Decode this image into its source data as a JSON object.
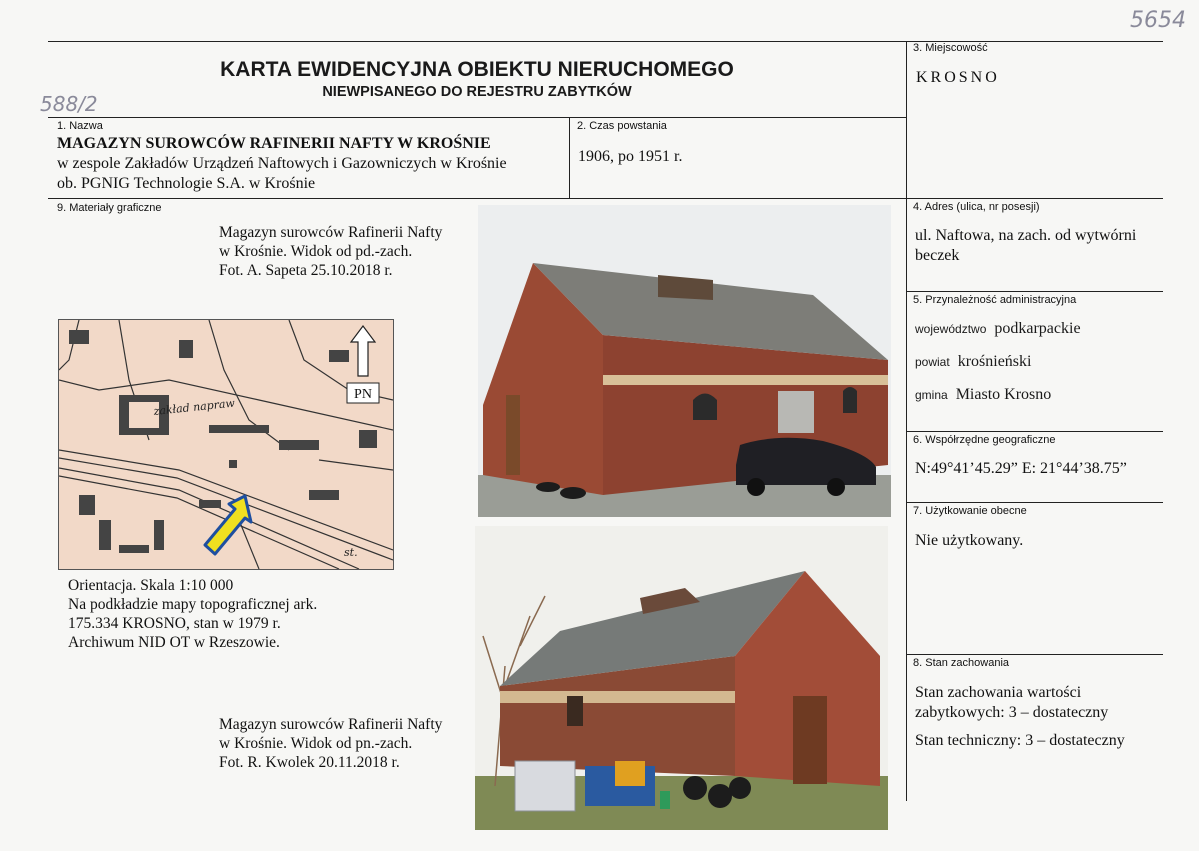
{
  "handwritten": {
    "top_right": "5654",
    "left": "588/2"
  },
  "header": {
    "title": "KARTA EWIDENCYJNA OBIEKTU NIERUCHOMEGO",
    "subtitle": "NIEWPISANEGO DO REJESTRU ZABYTKÓW"
  },
  "fields": {
    "f1": {
      "label": "1. Nazwa",
      "name_bold": "MAGAZYN SUROWCÓW RAFINERII NAFTY W KROŚNIE",
      "line2": "w zespole Zakładów Urządzeń Naftowych i Gazowniczych w  Krośnie",
      "line3": "ob. PGNIG Technologie S.A. w Krośnie"
    },
    "f2": {
      "label": "2. Czas powstania",
      "value": "1906, po 1951 r."
    },
    "f3": {
      "label": "3. Miejscowość",
      "value": "KROSNO"
    },
    "f4": {
      "label": "4. Adres (ulica, nr posesji)",
      "line1": "ul. Naftowa, na zach. od wytwórni",
      "line2": "beczek"
    },
    "f5": {
      "label": "5. Przynależność administracyjna",
      "woj_k": "województwo",
      "woj_v": "podkarpackie",
      "pow_k": "powiat",
      "pow_v": "krośnieński",
      "gm_k": "gmina",
      "gm_v": "Miasto Krosno"
    },
    "f6": {
      "label": "6. Współrzędne geograficzne",
      "value": "N:49°41’45.29” E: 21°44’38.75”"
    },
    "f7": {
      "label": "7. Użytkowanie obecne",
      "value": "Nie użytkowany."
    },
    "f8": {
      "label": "8. Stan zachowania",
      "line1": "Stan zachowania wartości",
      "line2": "zabytkowych: 3 – dostateczny",
      "line3": "Stan techniczny: 3 – dostateczny"
    },
    "f9": {
      "label": "9. Materiały graficzne"
    }
  },
  "captions": {
    "photo1": [
      "Magazyn surowców Rafinerii Nafty",
      "w Krośnie. Widok od pd.-zach.",
      "Fot. A. Sapeta 25.10.2018 r."
    ],
    "map": [
      "Orientacja. Skala 1:10 000",
      "Na podkładzie mapy topograficznej ark.",
      "175.334 KROSNO, stan w 1979 r.",
      "Archiwum NID OT w Rzeszowie."
    ],
    "photo2": [
      "Magazyn surowców Rafinerii Nafty",
      "w Krośnie. Widok od pn.-zach.",
      "Fot. R. Kwolek 20.11.2018 r."
    ]
  },
  "map": {
    "north_label": "PN",
    "text1": "zakład napraw",
    "text2": "st."
  },
  "colors": {
    "map_bg": "#f2d9c8",
    "arrow_fill": "#f0e020",
    "arrow_stroke": "#1e4fa0",
    "brick": "#9a4a34",
    "roof": "#7d7d78"
  }
}
